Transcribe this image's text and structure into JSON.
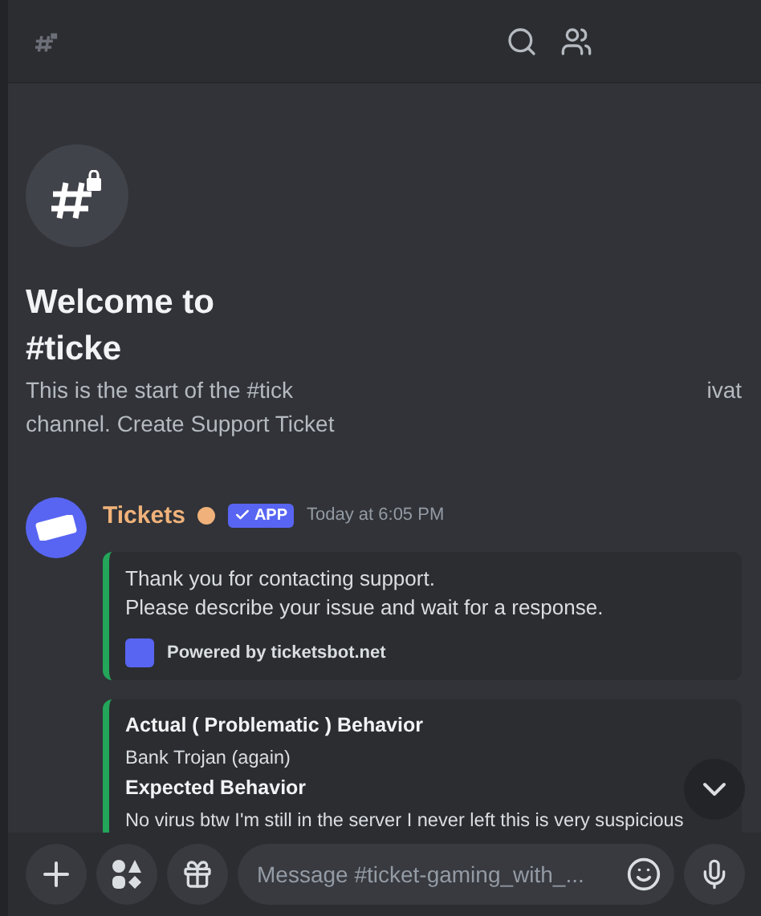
{
  "welcome": {
    "title_lines": [
      "Welcome to",
      "#ticke"
    ],
    "intro_parts": [
      "This is the start of the #tick",
      "ivat"
    ],
    "intro_second_line": "channel. Create Support Ticket"
  },
  "message": {
    "author": "Tickets",
    "badge": "APP",
    "time": "Today at 6:05 PM",
    "embeds": [
      {
        "kind": "text",
        "lines": [
          "Thank you for contacting support.",
          "Please describe your issue and wait for a response."
        ],
        "footer": "Powered by ticketsbot.net"
      },
      {
        "kind": "fields",
        "fields": [
          {
            "name": "Actual ( Problematic ) Behavior",
            "value": "Bank Trojan (again)"
          },
          {
            "name": "Expected Behavior",
            "value": "No virus btw I'm still in the server I never left this is very suspicious"
          }
        ]
      }
    ]
  },
  "composer": {
    "placeholder": "Message #ticket-gaming_with_..."
  }
}
